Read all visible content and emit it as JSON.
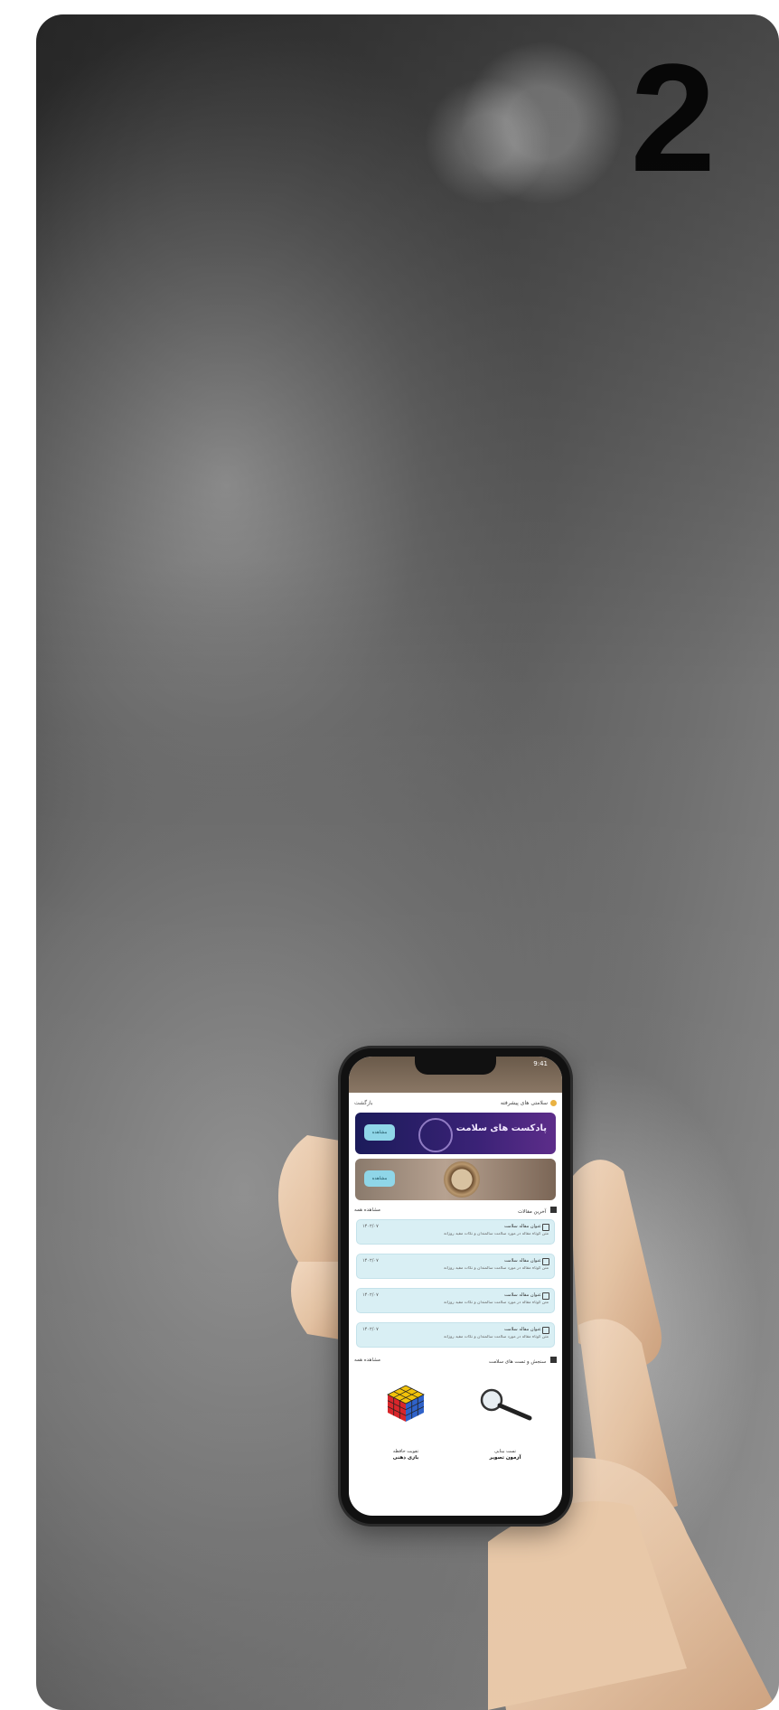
{
  "image": {
    "step_number": "2",
    "background": "grayscale photo of an elderly woman with glasses in a floral shirt, looking down",
    "hand": "wooden mannequin hand holding a smartphone"
  },
  "phone": {
    "status_time": "9:41",
    "header": {
      "title": "سلامتی های پیشرفته",
      "back_label": "بازگشت"
    },
    "banners": [
      {
        "title": "پادکست های سلامت",
        "button": "مشاهده"
      },
      {
        "title": "",
        "button": "مشاهده"
      }
    ],
    "news_section": {
      "title": "آخرین مقالات",
      "more": "مشاهده همه"
    },
    "news_items": [
      {
        "title": "عنوان مقاله سلامت",
        "date": "۱۴۰۲/۰۷",
        "text": "متن کوتاه مقاله در مورد سلامت سالمندان و نکات مفید روزانه"
      },
      {
        "title": "عنوان مقاله سلامت",
        "date": "۱۴۰۲/۰۷",
        "text": "متن کوتاه مقاله در مورد سلامت سالمندان و نکات مفید روزانه"
      },
      {
        "title": "عنوان مقاله سلامت",
        "date": "۱۴۰۲/۰۷",
        "text": "متن کوتاه مقاله در مورد سلامت سالمندان و نکات مفید روزانه"
      },
      {
        "title": "عنوان مقاله سلامت",
        "date": "۱۴۰۲/۰۷",
        "text": "متن کوتاه مقاله در مورد سلامت سالمندان و نکات مفید روزانه"
      }
    ],
    "tools_section": {
      "title": "سنجش و تست های سلامت",
      "more": "مشاهده همه"
    },
    "tools": [
      {
        "label": "تقویت حافظه",
        "sub": "بازی ذهنی"
      },
      {
        "label": "تست بینایی",
        "sub": "آزمون تصویر"
      }
    ]
  },
  "colors": {
    "banner_button": "#8fd6e8",
    "news_bg": "#d9eff4",
    "header_dot": "#e9b243"
  }
}
